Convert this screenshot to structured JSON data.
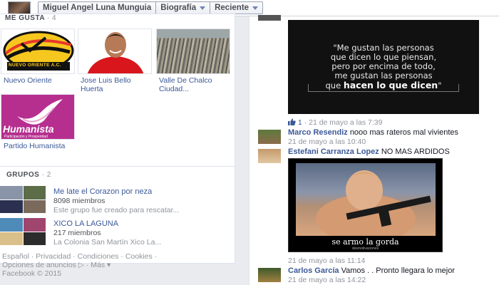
{
  "topbar": {
    "profile_name": "Miguel Angel Luna Munguia",
    "section_label": "Biografía",
    "filter_label": "Reciente"
  },
  "likes": {
    "title": "ME GUSTA",
    "count": "· 4",
    "items": [
      {
        "name": "Nuevo Oriente",
        "logo_text": "NUEVO ORIENTE A.C."
      },
      {
        "name": "Jose Luis Bello Huerta"
      },
      {
        "name": "Valle De Chalco Ciudad..."
      },
      {
        "name": "Partido Humanista",
        "logo_text": "Humanista",
        "logo_sub": "Participación y Prosperidad"
      }
    ]
  },
  "groups": {
    "title": "GRUPOS",
    "count": "· 2",
    "items": [
      {
        "name": "Me late el Corazon por neza",
        "members": "8098 miembros",
        "desc": "Este grupo fue creado para rescatar..."
      },
      {
        "name": "XICO LA LAGUNA",
        "members": "217 miembros",
        "desc": "La Colonia San Martín Xico La..."
      }
    ]
  },
  "footer": {
    "links": [
      "Español",
      "Privacidad",
      "Condiciones",
      "Cookies",
      "Opciones de anuncios",
      "Más"
    ],
    "copyright": "Facebook © 2015"
  },
  "feed": {
    "quote_image": {
      "lines": [
        "\"Me gustan las personas",
        "que dicen lo que piensan,",
        "pero por encima de todo,",
        "me gustan las personas"
      ],
      "last_prefix": "que",
      "last_bold": "hacen lo que dicen",
      "last_suffix": "\""
    },
    "post_meta": {
      "like_count": "1",
      "time": "· 21 de mayo a las 7:39"
    },
    "comments": [
      {
        "author": "Marco Resendiz",
        "text": "nooo mas rateros mal vivientes",
        "time": "21 de mayo a las 10:40"
      },
      {
        "author": "Estefani Carranza Lopez",
        "text": "NO MAS ARDIDOS",
        "time": "21 de mayo a las 11:14"
      },
      {
        "author": "Carlos García",
        "text": "Vamos . . Pronto llegara lo mejor",
        "time": "21 de mayo a las 14:22"
      }
    ],
    "meme": {
      "caption": "se armo la gorda",
      "sub": "desmotivaciones"
    }
  },
  "colors": {
    "link": "#3b5998",
    "muted": "#90949c",
    "humanista": "#b62f8f"
  }
}
